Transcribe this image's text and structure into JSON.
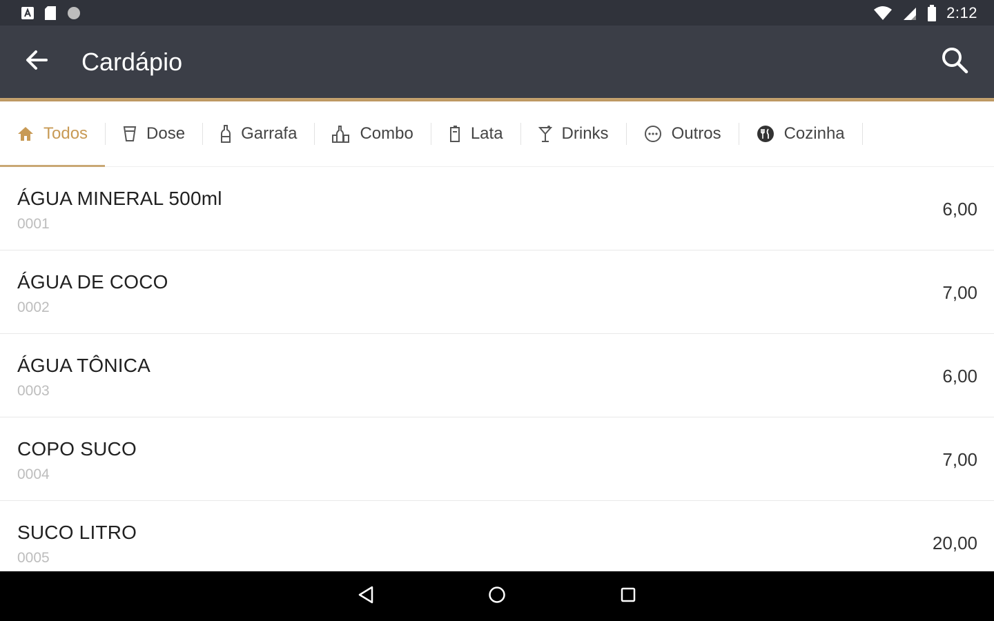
{
  "status_bar": {
    "time": "2:12",
    "icons": [
      "a-notification-icon",
      "sd-card-icon",
      "circle-notification-icon",
      "wifi-icon",
      "signal-icon",
      "battery-icon"
    ]
  },
  "app_bar": {
    "title": "Cardápio",
    "back_icon": "arrow-back-icon",
    "search_icon": "search-icon",
    "background": "#3b3e47",
    "accent": "#c9a774"
  },
  "tabs": [
    {
      "label": "Todos",
      "icon": "home-icon",
      "active": true
    },
    {
      "label": "Dose",
      "icon": "shot-glass-icon",
      "active": false
    },
    {
      "label": "Garrafa",
      "icon": "bottle-icon",
      "active": false
    },
    {
      "label": "Combo",
      "icon": "combo-icon",
      "active": false
    },
    {
      "label": "Lata",
      "icon": "can-icon",
      "active": false
    },
    {
      "label": "Drinks",
      "icon": "cocktail-icon",
      "active": false
    },
    {
      "label": "Outros",
      "icon": "more-circle-icon",
      "active": false
    },
    {
      "label": "Cozinha",
      "icon": "kitchen-icon",
      "active": false
    }
  ],
  "items": [
    {
      "name": "ÁGUA MINERAL 500ml",
      "code": "0001",
      "price": "6,00"
    },
    {
      "name": "ÁGUA DE COCO",
      "code": "0002",
      "price": "7,00"
    },
    {
      "name": "ÁGUA TÔNICA",
      "code": "0003",
      "price": "6,00"
    },
    {
      "name": "COPO SUCO",
      "code": "0004",
      "price": "7,00"
    },
    {
      "name": "SUCO LITRO",
      "code": "0005",
      "price": "20,00"
    }
  ],
  "nav_bar": {
    "icons": [
      "back-triangle-icon",
      "home-circle-icon",
      "recents-square-icon"
    ]
  }
}
